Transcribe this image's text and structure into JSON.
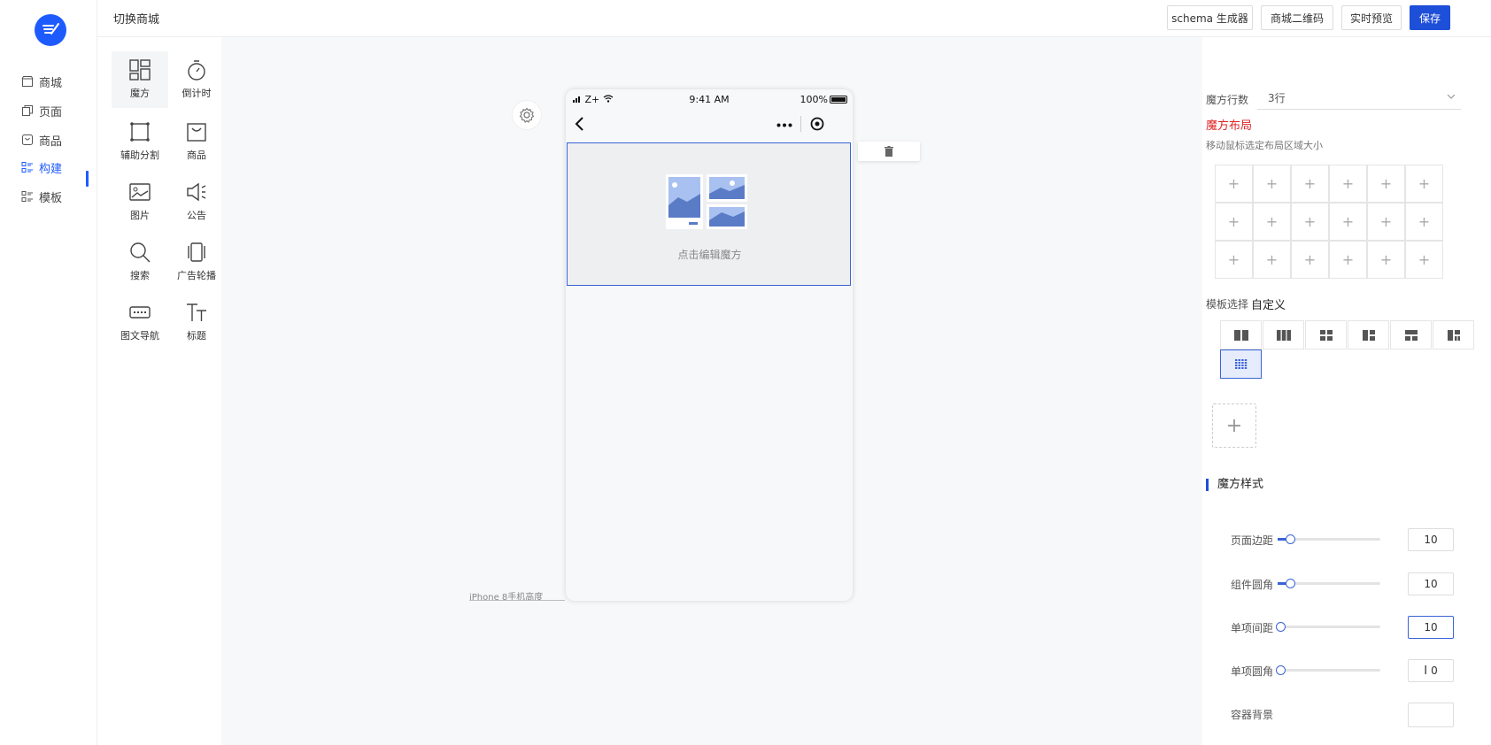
{
  "topbar": {
    "switch_shop": "切换商城",
    "buttons": [
      "schema 生成器",
      "商城二维码",
      "实时预览",
      "保存"
    ]
  },
  "leftnav": {
    "items": [
      {
        "label": "商城",
        "icon": "store-icon"
      },
      {
        "label": "页面",
        "icon": "page-icon"
      },
      {
        "label": "商品",
        "icon": "goods-icon"
      },
      {
        "label": "构建",
        "icon": "build-icon",
        "active": true
      },
      {
        "label": "模板",
        "icon": "template-icon"
      }
    ]
  },
  "palette": {
    "items": [
      "魔方",
      "倒计时",
      "辅助分割",
      "商品",
      "图片",
      "公告",
      "搜索",
      "广告轮播",
      "图文导航",
      "标题"
    ]
  },
  "phone": {
    "carrier": "Z+",
    "time": "9:41 AM",
    "battery": "100%",
    "hint": "点击编辑魔方"
  },
  "canvas": {
    "device_label": "iPhone 8手机高度"
  },
  "right_panel": {
    "rows_label": "魔方行数",
    "rows_value": "3行",
    "layout_label": "魔方布局",
    "layout_hint": "移动鼠标选定布局区域大小",
    "grid": {
      "rows": 3,
      "cols": 6
    },
    "template_label": "模板选择",
    "template_value": "自定义",
    "style_title": "魔方样式",
    "settings": [
      {
        "label": "页面边距",
        "value": "10",
        "fraction": 0.12
      },
      {
        "label": "组件圆角",
        "value": "10",
        "fraction": 0.12
      },
      {
        "label": "单项间距",
        "value": "10",
        "fraction": 0.0
      },
      {
        "label": "单项圆角",
        "value": "0",
        "fraction": 0.0
      }
    ],
    "bg_label": "容器背景"
  },
  "colors": {
    "accent": "#1e4fd8",
    "danger": "#e02424"
  }
}
